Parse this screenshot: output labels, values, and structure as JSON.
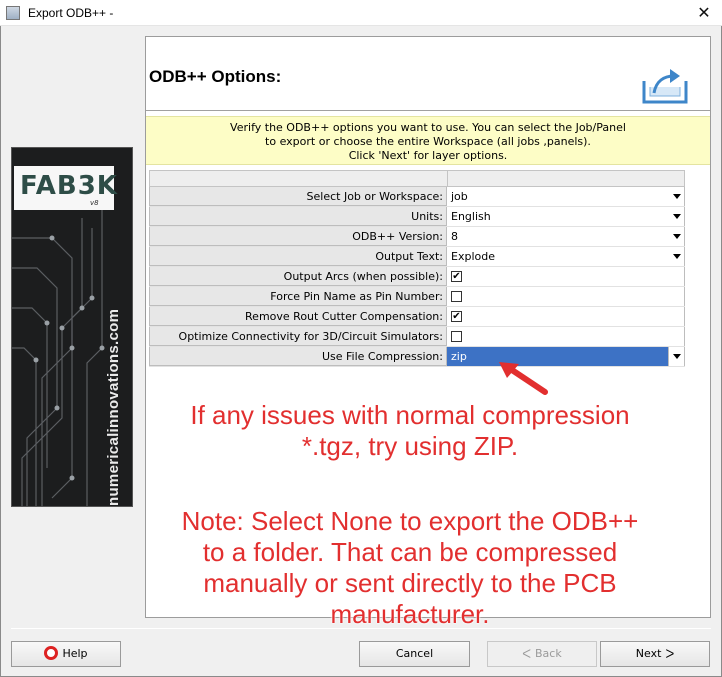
{
  "window": {
    "title": "Export ODB++ -"
  },
  "sidebar": {
    "logo_text": "FAB3K",
    "logo_version": "v8",
    "url_text": "numericalinnovations.com"
  },
  "header": {
    "title": "ODB++ Options:"
  },
  "info": {
    "line1": "Verify the ODB++ options you want to use.  You can select the Job/Panel",
    "line2": "to export or choose the entire Workspace (all jobs ,panels).",
    "line3": "Click 'Next' for layer options."
  },
  "options": [
    {
      "label": "Select Job or Workspace:",
      "type": "dropdown",
      "value": "job"
    },
    {
      "label": "Units:",
      "type": "dropdown",
      "value": "English"
    },
    {
      "label": "ODB++ Version:",
      "type": "dropdown",
      "value": "8"
    },
    {
      "label": "Output Text:",
      "type": "dropdown",
      "value": "Explode"
    },
    {
      "label": "Output Arcs (when possible):",
      "type": "checkbox",
      "checked": true
    },
    {
      "label": "Force Pin Name as Pin Number:",
      "type": "checkbox",
      "checked": false
    },
    {
      "label": "Remove Rout Cutter Compensation:",
      "type": "checkbox",
      "checked": true
    },
    {
      "label": "Optimize Connectivity for 3D/Circuit Simulators:",
      "type": "checkbox",
      "checked": false
    },
    {
      "label": "Use File Compression:",
      "type": "dropdown",
      "value": "zip",
      "selected": true
    }
  ],
  "annotations": {
    "note1_line1": "If any issues with normal compression",
    "note1_line2": "*.tgz, try using ZIP.",
    "note2_line1": "Note: Select None to export the ODB++",
    "note2_line2": "to a folder. That can be compressed",
    "note2_line3": "manually or sent directly to the PCB",
    "note2_line4": "manufacturer."
  },
  "buttons": {
    "help": "Help",
    "cancel": "Cancel",
    "back": "Back",
    "next": "Next"
  },
  "colors": {
    "annotation": "#e22f2f",
    "info_bg": "#fdfdc6",
    "selection": "#3d72c5"
  }
}
